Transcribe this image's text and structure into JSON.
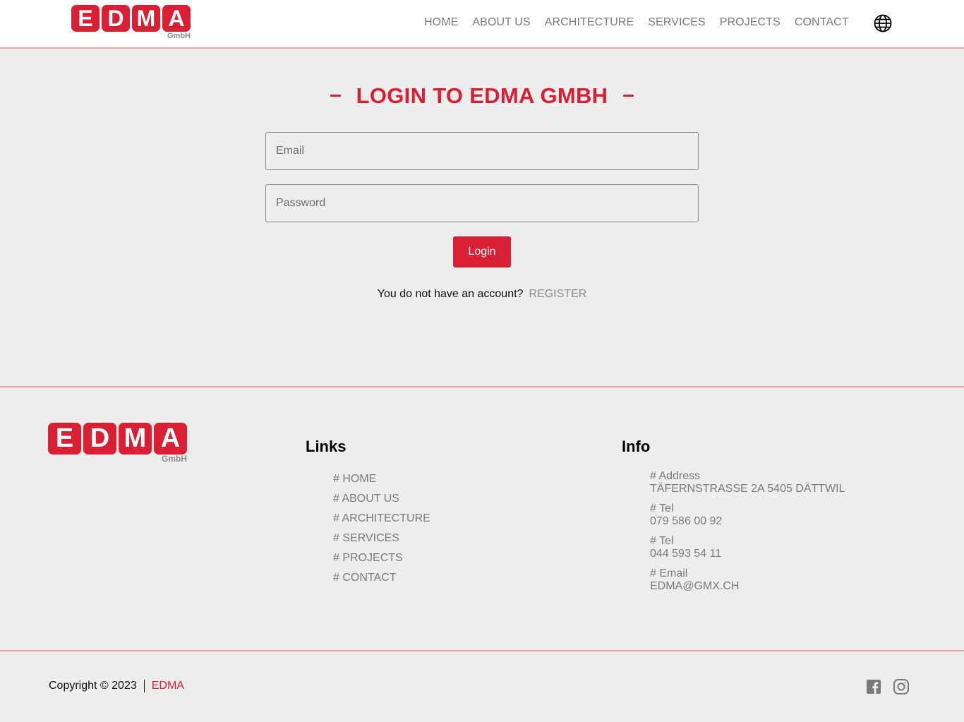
{
  "header": {
    "logo": {
      "letters": [
        "E",
        "D",
        "M",
        "A"
      ],
      "sub": "GmbH"
    },
    "nav": [
      "HOME",
      "ABOUT US",
      "ARCHITECTURE",
      "SERVICES",
      "PROJECTS",
      "CONTACT"
    ],
    "language_icon": "globe-icon"
  },
  "login": {
    "title": "LOGIN TO EDMA GMBH",
    "email_placeholder": "Email",
    "password_placeholder": "Password",
    "button_label": "Login",
    "no_account_text": "You do not have an account?",
    "register_link": "REGISTER"
  },
  "footer": {
    "logo": {
      "letters": [
        "E",
        "D",
        "M",
        "A"
      ],
      "sub": "GmbH"
    },
    "links_heading": "Links",
    "links": [
      "# HOME",
      "# ABOUT US",
      "# ARCHITECTURE",
      "# SERVICES",
      "# PROJECTS",
      "# CONTACT"
    ],
    "info_heading": "Info",
    "info": [
      {
        "label": "# Address",
        "value": "TÄFERNSTRASSE 2A 5405 DÄTTWIL"
      },
      {
        "label": "# Tel",
        "value": "079 586 00 92"
      },
      {
        "label": "# Tel",
        "value": "044 593 54 11"
      },
      {
        "label": "# Email",
        "value": "EDMA@GMX.CH"
      }
    ],
    "copyright": "Copyright © 2023",
    "brand": "EDMA",
    "social_icons": [
      "facebook-icon",
      "instagram-icon"
    ]
  },
  "colors": {
    "brand_red": "#d81f34",
    "divider_pink": "#f0a3aa",
    "muted_text": "#7a7a7a",
    "background": "#ededed"
  }
}
